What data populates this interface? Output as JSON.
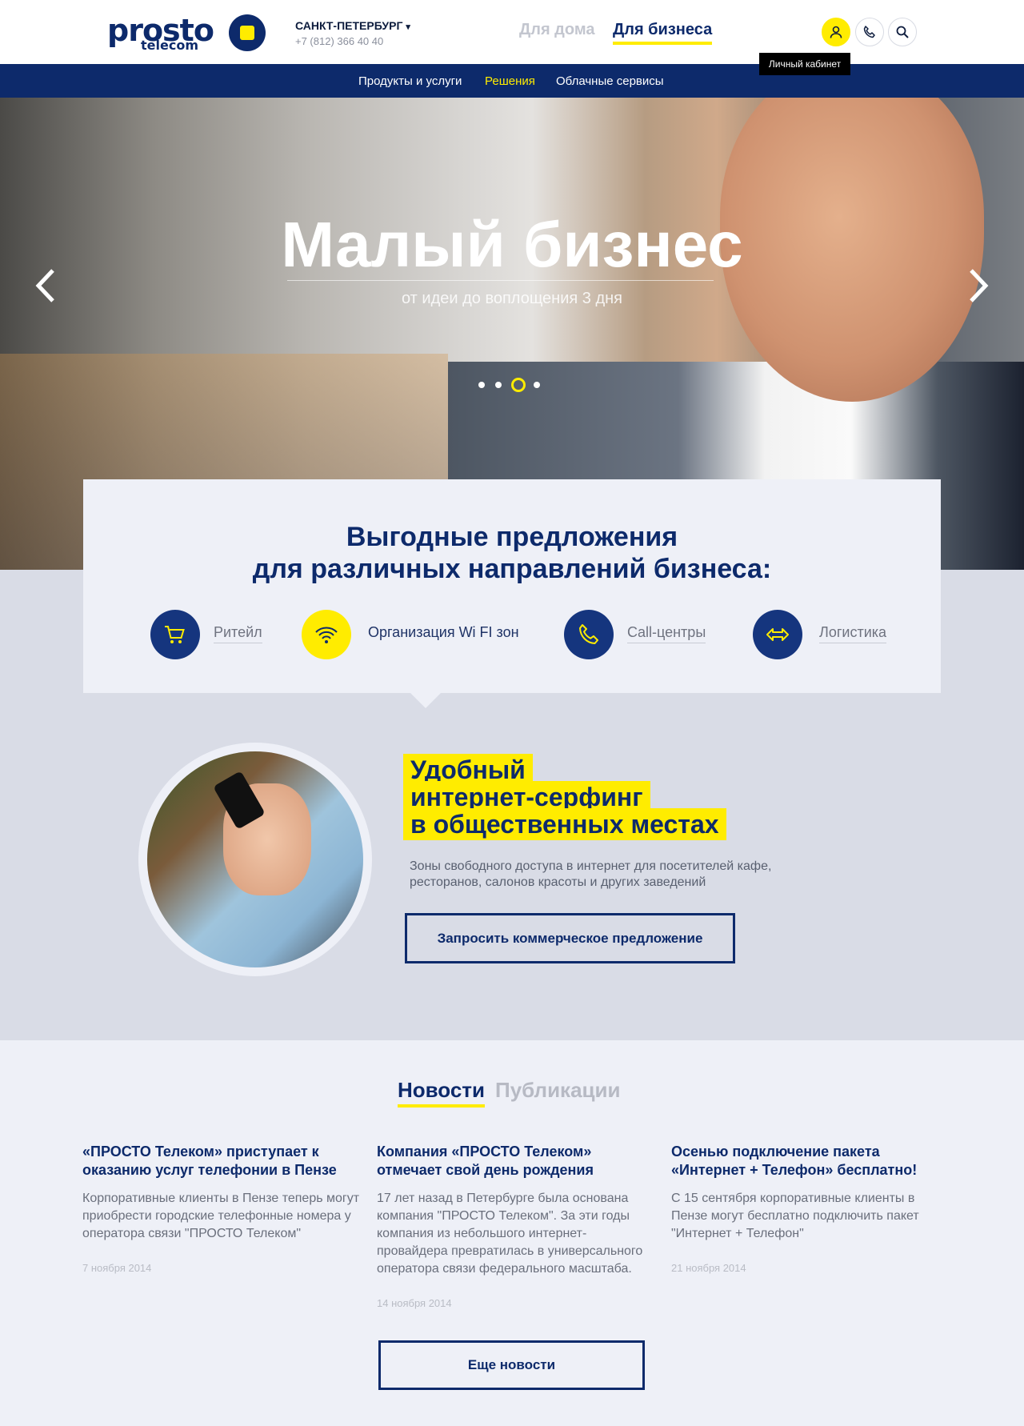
{
  "header": {
    "logo_text": "prosto",
    "logo_sub": "telecom",
    "city": "САНКТ-ПЕТЕРБУРГ",
    "phone": "+7 (812) 366 40 40",
    "segments": {
      "home": "Для дома",
      "business": "Для бизнеса"
    },
    "icons": [
      "user-icon",
      "phone-icon",
      "search-icon"
    ],
    "tooltip": "Личный кабинет"
  },
  "nav": {
    "items": [
      {
        "label": "Продукты и услуги",
        "active": false
      },
      {
        "label": "Решения",
        "active": true
      },
      {
        "label": "Облачные сервисы",
        "active": false
      }
    ]
  },
  "hero": {
    "title": "Малый бизнес",
    "subtitle": "от идеи до воплощения 3 дня",
    "slide_count": 4,
    "active_slide": 3
  },
  "offers": {
    "title_line1": "Выгодные предложения",
    "title_line2": "для различных направлений бизнеса:",
    "categories": [
      {
        "label": "Ритейл",
        "icon": "cart-icon"
      },
      {
        "label": "Организация Wi FI зон",
        "icon": "wifi-icon"
      },
      {
        "label": "Call-центры",
        "icon": "phone-icon"
      },
      {
        "label": "Логистика",
        "icon": "arrows-icon"
      }
    ]
  },
  "feature": {
    "heading_lines": [
      "Удобный",
      "интернет-серфинг",
      "в общественных местах"
    ],
    "description": "Зоны свободного доступа в интернет для посетителей кафе, ресторанов, салонов красоты и других заведений",
    "button": "Запросить коммерческое предложение"
  },
  "news": {
    "tabs": {
      "news": "Новости",
      "publications": "Публикации"
    },
    "items": [
      {
        "title": "«ПРОСТО Телеком» приступает к оказанию услуг телефонии в Пензе",
        "body": "Корпоративные клиенты в Пензе теперь могут приобрести городские телефонные номера у оператора связи \"ПРОСТО Телеком\"",
        "date": "7 ноября 2014"
      },
      {
        "title": "Компания «ПРОСТО Телеком» отмечает свой день рождения",
        "body": "17 лет назад в Петербурге была основана компания \"ПРОСТО Телеком\". За эти годы компания  из небольшого интернет-провайдера превратилась в универсального оператора связи федерального масштаба.",
        "date": "14 ноября 2014"
      },
      {
        "title": "Осенью подключение пакета «Интернет + Телефон» бесплатно!",
        "body": "С 15 сентября корпоративные клиенты в Пензе могут бесплатно подключить пакет \"Интернет + Телефон\"",
        "date": "21 ноября 2014"
      }
    ],
    "more_button": "Еще новости"
  },
  "colors": {
    "brand": "#0d2a6b",
    "accent": "#ffec00"
  }
}
